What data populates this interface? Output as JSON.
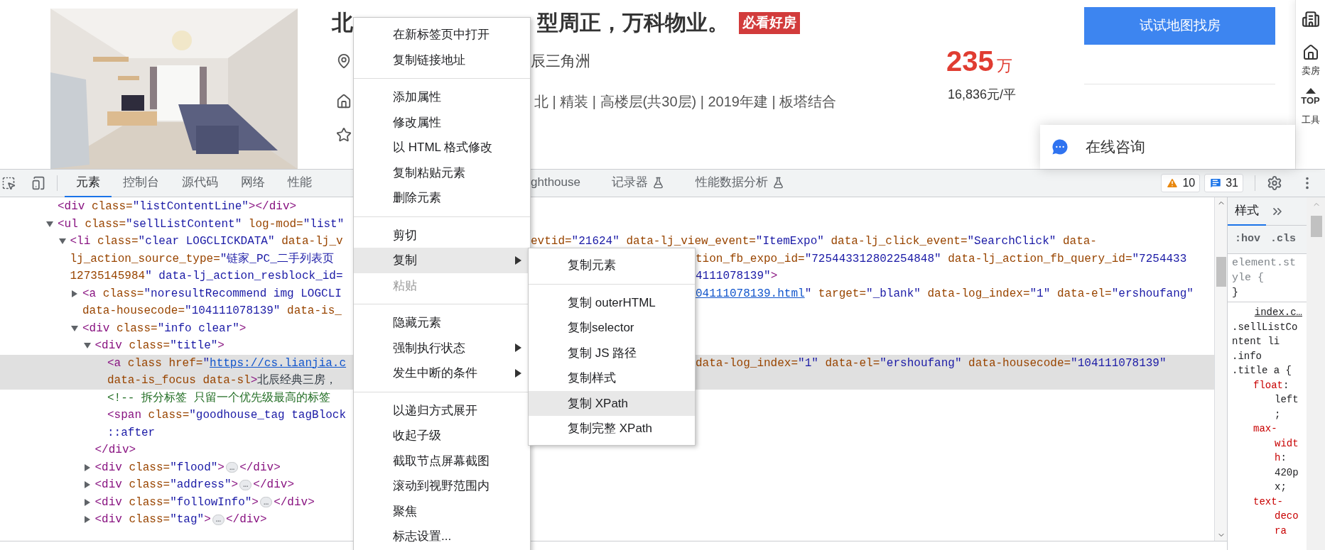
{
  "listing": {
    "title_parts": [
      "北",
      "型周正，万科物业。"
    ],
    "badge": "必看好房",
    "location": "辰三角洲",
    "house_info": "北 | 精装 | 高楼层(共30层) | 2019年建 | 板塔结合",
    "price": {
      "total": "235",
      "unit": "万",
      "per_area": "16,836元/平"
    },
    "map_button": "试试地图找房",
    "consult": "在线咨询",
    "side_tools": [
      {
        "kind": "building"
      },
      {
        "kind": "sell",
        "label": "卖房"
      },
      {
        "kind": "top",
        "label": "TOP"
      },
      {
        "kind": "tools",
        "label": "工具"
      }
    ]
  },
  "devtools": {
    "tabs": [
      {
        "label": "元素",
        "selected": true,
        "experimental": false
      },
      {
        "label": "控制台",
        "selected": false,
        "experimental": false
      },
      {
        "label": "源代码",
        "selected": false,
        "experimental": false
      },
      {
        "label": "网络",
        "selected": false,
        "experimental": false
      },
      {
        "label": "性能",
        "selected": false,
        "experimental": false
      },
      {
        "label": "ghthouse",
        "selected": false,
        "experimental": false
      },
      {
        "label": "记录器",
        "selected": false,
        "experimental": true
      },
      {
        "label": "性能数据分析",
        "selected": false,
        "experimental": true
      }
    ],
    "warnings": "10",
    "messages": "31",
    "tree": [
      {
        "selected": false,
        "lines": [
          {
            "left": [
              {
                "kind": "code",
                "text": "<div class=\"listContentLine\"></div>"
              }
            ]
          }
        ]
      },
      {
        "selected": false,
        "expanded": true,
        "lines": [
          {
            "left": [
              {
                "kind": "code",
                "text": "<ul class=\"sellListContent\" log-mod=\"list\""
              }
            ]
          }
        ],
        "children": [
          {
            "selected": false,
            "expanded": true,
            "lines": [
              {
                "left": [
                  {
                    "kind": "code",
                    "text": "<li class=\"clear LOGCLICKDATA\" data-lj_v"
                  }
                ],
                "right": [
                  {
                    "kind": "code",
                    "text": "evtid=\"21624\" data-lj_view_event=\"ItemExpo\" data-lj_click_event=\"SearchClick\" data-"
                  }
                ]
              },
              {
                "left": [
                  {
                    "kind": "code",
                    "text": "lj_action_source_type=\"链家_PC_二手列表页"
                  }
                ],
                "right": [
                  {
                    "kind": "code",
                    "text": "tion_fb_expo_id=\"725443312802254848\" data-lj_action_fb_query_id=\"7254433"
                  }
                ]
              },
              {
                "left": [
                  {
                    "kind": "code",
                    "text": "12735145984\" data-lj_action_resblock_id="
                  }
                ],
                "right": [
                  {
                    "kind": "value",
                    "text": "4111078139\""
                  },
                  {
                    "kind": "code",
                    "text": ">"
                  }
                ]
              }
            ],
            "children": [
              {
                "selected": false,
                "expanded": false,
                "lines": [
                  {
                    "left": [
                      {
                        "kind": "code",
                        "text": "<a class=\"noresultRecommend img LOGCLI"
                      }
                    ],
                    "right": [
                      {
                        "kind": "link",
                        "text": "04111078139.html"
                      },
                      {
                        "kind": "value",
                        "text": "\""
                      },
                      {
                        "kind": "code",
                        "text": " target=\"_blank\" data-log_index=\"1\" data-el=\"ershoufang\""
                      }
                    ]
                  },
                  {
                    "left": [
                      {
                        "kind": "code",
                        "text": "data-housecode=\"104111078139\" data-is_"
                      }
                    ]
                  }
                ]
              },
              {
                "selected": false,
                "expanded": true,
                "lines": [
                  {
                    "left": [
                      {
                        "kind": "code",
                        "text": "<div class=\"info clear\">"
                      }
                    ]
                  }
                ],
                "children": [
                  {
                    "selected": false,
                    "expanded": true,
                    "lines": [
                      {
                        "left": [
                          {
                            "kind": "code",
                            "text": "<div class=\"title\">"
                          }
                        ]
                      }
                    ],
                    "close": [
                      {
                        "kind": "code",
                        "text": "</div>"
                      }
                    ],
                    "children": [
                      {
                        "selected": true,
                        "lines": [
                          {
                            "left": [
                              {
                                "kind": "code",
                                "text": "<a class href=\""
                              },
                              {
                                "kind": "link",
                                "text": "https://cs.lianjia.c"
                              }
                            ],
                            "right": [
                              {
                                "kind": "code",
                                "text": "data-log_index=\"1\" data-el=\"ershoufang\" data-housecode=\"104111078139\""
                              }
                            ]
                          },
                          {
                            "left": [
                              {
                                "kind": "code",
                                "text": "data-is_focus data-sl>"
                              },
                              {
                                "kind": "text",
                                "text": "北辰经典三房，"
                              }
                            ]
                          }
                        ]
                      },
                      {
                        "selected": false,
                        "lines": [
                          {
                            "left": [
                              {
                                "kind": "comment",
                                "text": "<!-- 拆分标签 只留一个优先级最高的标签"
                              }
                            ]
                          }
                        ]
                      },
                      {
                        "selected": false,
                        "lines": [
                          {
                            "left": [
                              {
                                "kind": "code",
                                "text": "<span class=\"goodhouse_tag tagBlock"
                              }
                            ]
                          }
                        ]
                      },
                      {
                        "selected": false,
                        "lines": [
                          {
                            "left": [
                              {
                                "kind": "pseudo",
                                "text": "::after"
                              }
                            ]
                          }
                        ]
                      }
                    ]
                  },
                  {
                    "selected": false,
                    "expanded": false,
                    "lines": [
                      {
                        "left": [
                          {
                            "kind": "code",
                            "text": "<div class=\"flood\">"
                          },
                          {
                            "kind": "ellipsis",
                            "text": "…"
                          },
                          {
                            "kind": "code",
                            "text": "</div>"
                          }
                        ]
                      }
                    ]
                  },
                  {
                    "selected": false,
                    "expanded": false,
                    "lines": [
                      {
                        "left": [
                          {
                            "kind": "code",
                            "text": "<div class=\"address\">"
                          },
                          {
                            "kind": "ellipsis",
                            "text": "…"
                          },
                          {
                            "kind": "code",
                            "text": "</div>"
                          }
                        ]
                      }
                    ]
                  },
                  {
                    "selected": false,
                    "expanded": false,
                    "lines": [
                      {
                        "left": [
                          {
                            "kind": "code",
                            "text": "<div class=\"followInfo\">"
                          },
                          {
                            "kind": "ellipsis",
                            "text": "…"
                          },
                          {
                            "kind": "code",
                            "text": "</div>"
                          }
                        ]
                      }
                    ]
                  },
                  {
                    "selected": false,
                    "expanded": false,
                    "lines": [
                      {
                        "left": [
                          {
                            "kind": "code",
                            "text": "<div class=\"tag\">"
                          },
                          {
                            "kind": "ellipsis",
                            "text": "…"
                          },
                          {
                            "kind": "code",
                            "text": "</div>"
                          }
                        ]
                      }
                    ]
                  }
                ]
              }
            ]
          }
        ]
      }
    ],
    "styles": {
      "tab": {
        "label": "样式",
        "selected": true
      },
      "toggles": [
        ":hov",
        ".cls"
      ],
      "element_rule": {
        "selector": "element.style {",
        "close": "}"
      },
      "rule": {
        "source": "index.c…",
        "selector": ".sellListContent li .info .title a {",
        "declarations": [
          {
            "name": "float",
            "rest": ": left;"
          },
          {
            "name": "max-width",
            "rest": ": 420px;"
          },
          {
            "name": "text-decora"
          }
        ]
      }
    }
  },
  "context_menu": {
    "groups": [
      [
        {
          "label": "在新标签页中打开",
          "highlighted": false,
          "disabled": false,
          "submenu": false
        },
        {
          "label": "复制链接地址",
          "highlighted": false,
          "disabled": false,
          "submenu": false
        }
      ],
      [
        {
          "label": "添加属性",
          "highlighted": false,
          "disabled": false,
          "submenu": false
        },
        {
          "label": "修改属性",
          "highlighted": false,
          "disabled": false,
          "submenu": false
        },
        {
          "label": "以 HTML 格式修改",
          "highlighted": false,
          "disabled": false,
          "submenu": false
        },
        {
          "label": "复制粘贴元素",
          "highlighted": false,
          "disabled": false,
          "submenu": false
        },
        {
          "label": "删除元素",
          "highlighted": false,
          "disabled": false,
          "submenu": false
        }
      ],
      [
        {
          "label": "剪切",
          "highlighted": false,
          "disabled": false,
          "submenu": false
        },
        {
          "label": "复制",
          "highlighted": true,
          "disabled": false,
          "submenu": true
        },
        {
          "label": "粘贴",
          "highlighted": false,
          "disabled": true,
          "submenu": false
        }
      ],
      [
        {
          "label": "隐藏元素",
          "highlighted": false,
          "disabled": false,
          "submenu": false
        },
        {
          "label": "强制执行状态",
          "highlighted": false,
          "disabled": false,
          "submenu": true
        },
        {
          "label": "发生中断的条件",
          "highlighted": false,
          "disabled": false,
          "submenu": true
        }
      ],
      [
        {
          "label": "以递归方式展开",
          "highlighted": false,
          "disabled": false,
          "submenu": false
        },
        {
          "label": "收起子级",
          "highlighted": false,
          "disabled": false,
          "submenu": false
        },
        {
          "label": "截取节点屏幕截图",
          "highlighted": false,
          "disabled": false,
          "submenu": false
        },
        {
          "label": "滚动到视野范围内",
          "highlighted": false,
          "disabled": false,
          "submenu": false
        },
        {
          "label": "聚焦",
          "highlighted": false,
          "disabled": false,
          "submenu": false
        },
        {
          "label": "标志设置...",
          "highlighted": false,
          "disabled": false,
          "submenu": false
        }
      ]
    ]
  },
  "copy_submenu": {
    "groups": [
      [
        {
          "label": "复制元素",
          "highlighted": false
        }
      ],
      [
        {
          "label": "复制 outerHTML",
          "highlighted": false
        },
        {
          "label": "复制selector",
          "highlighted": false
        },
        {
          "label": "复制 JS 路径",
          "highlighted": false
        },
        {
          "label": "复制样式",
          "highlighted": false
        },
        {
          "label": "复制 XPath",
          "highlighted": true
        },
        {
          "label": "复制完整 XPath",
          "highlighted": false
        }
      ]
    ]
  }
}
